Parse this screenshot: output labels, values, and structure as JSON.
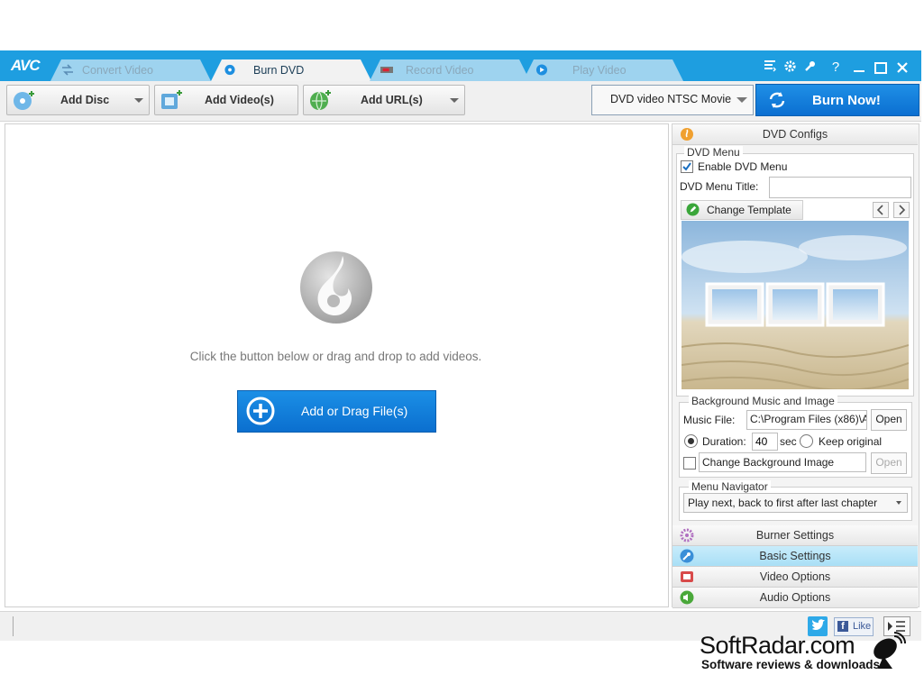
{
  "app": {
    "logo": "AVC"
  },
  "tabs": [
    {
      "label": "Convert Video",
      "icon": "convert-icon",
      "active": false
    },
    {
      "label": "Burn DVD",
      "icon": "disc-icon",
      "active": true
    },
    {
      "label": "Record Video",
      "icon": "record-icon",
      "active": false
    },
    {
      "label": "Play Video",
      "icon": "play-icon",
      "active": false
    }
  ],
  "window_controls": {
    "help": "?"
  },
  "toolbar": {
    "add_disc": "Add Disc",
    "add_videos": "Add Video(s)",
    "add_url": "Add URL(s)",
    "profile": "DVD video NTSC Movie",
    "burn_now": "Burn Now!"
  },
  "main": {
    "hint": "Click the button below or drag and drop to add videos.",
    "add_button": "Add or Drag File(s)"
  },
  "panel": {
    "dvd_configs": "DVD Configs",
    "dvd_menu_group": "DVD Menu",
    "enable_dvd_menu": "Enable DVD Menu",
    "enable_dvd_menu_checked": true,
    "menu_title_label": "DVD Menu Title:",
    "menu_title_value": "",
    "change_template": "Change Template",
    "bg_group": "Background Music and Image",
    "music_file_label": "Music File:",
    "music_file_value": "C:\\Program Files (x86)\\A",
    "open_label": "Open",
    "duration_label": "Duration:",
    "duration_value": "40",
    "duration_unit": "sec",
    "keep_original": "Keep original",
    "change_bg_image": "Change Background Image",
    "open_disabled_label": "Open",
    "menu_nav_group": "Menu Navigator",
    "menu_nav_value": "Play next, back to first after last chapter",
    "burner_settings": "Burner Settings",
    "basic_settings": "Basic Settings",
    "video_options": "Video Options",
    "audio_options": "Audio Options"
  },
  "status": {
    "like": "Like"
  },
  "watermark": {
    "brand": "SoftRadar.com",
    "tagline": "Software reviews & downloads"
  },
  "colors": {
    "accent": "#1e9ee0",
    "burn_button": "#0b6fd1",
    "tab_inactive": "#9ed3ef",
    "selected_panel": "#b8e6f9"
  }
}
